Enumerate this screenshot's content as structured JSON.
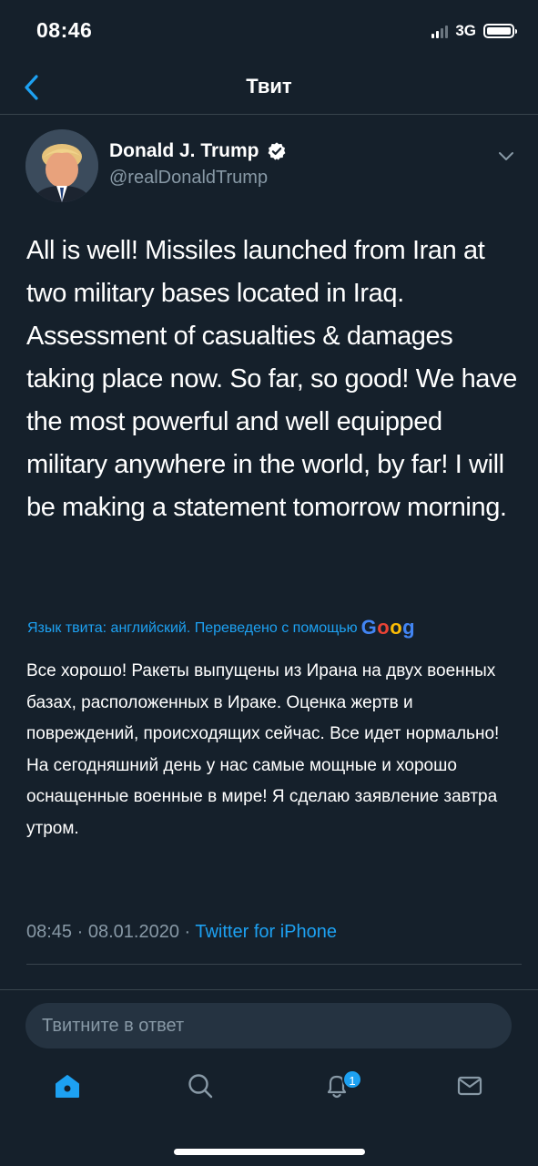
{
  "status_bar": {
    "time": "08:46",
    "network": "3G"
  },
  "nav": {
    "title": "Твит",
    "back_icon": "chevron-left-icon"
  },
  "author": {
    "name": "Donald J. Trump",
    "handle": "@realDonaldTrump",
    "verified": true
  },
  "tweet": {
    "text": "All is well! Missiles launched from Iran at two military bases located in Iraq. Assessment of casualties & damages taking place now. So far, so good! We have the most powerful and well equipped military anywhere in the world, by far! I will be making a statement tomorrow morning.",
    "translation_note": "Язык твита: английский. Переведено с помощью",
    "translation_provider": "Goog",
    "translated_text": "Все хорошо! Ракеты выпущены из Ирана на двух военных базах, расположенных в Ираке. Оценка жертв и повреждений, происходящих сейчас. Все идет нормально! На сегодняшний день у нас самые мощные и хорошо оснащенные военные в мире! Я сделаю заявление завтра утром.",
    "time": "08:45",
    "date": "08.01.2020",
    "source": "Twitter for iPhone"
  },
  "reply": {
    "placeholder": "Твитните в ответ"
  },
  "tab_bar": {
    "items": [
      {
        "icon": "home-icon",
        "active": true
      },
      {
        "icon": "search-icon",
        "active": false
      },
      {
        "icon": "notifications-icon",
        "active": false,
        "badge": "1"
      },
      {
        "icon": "messages-icon",
        "active": false
      }
    ]
  },
  "colors": {
    "background": "#15202b",
    "accent": "#1da1f2",
    "muted": "#8899a6",
    "divider": "#38444d"
  }
}
